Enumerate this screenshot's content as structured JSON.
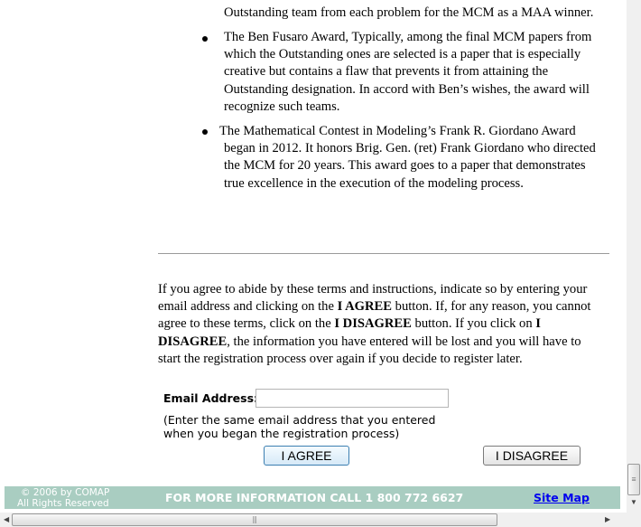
{
  "awards": {
    "top_line": "Outstanding team from each problem for the MCM as a MAA winner.",
    "items": [
      {
        "lines": [
          "The Ben Fusaro Award, Typically, among the final MCM papers from",
          "which the Outstanding ones are selected is a paper that is especially",
          "creative but contains a flaw that prevents it from attaining the",
          "Outstanding designation. In accord with Ben’s wishes, the award will",
          "recognize such teams."
        ]
      },
      {
        "lines": [
          "The Mathematical Contest in Modeling’s Frank R. Giordano Award",
          "began in 2012. It honors Brig. Gen. (ret) Frank Giordano who directed",
          "the MCM for 20 years. This award goes to a paper that demonstrates",
          "true excellence in the execution of the modeling process."
        ]
      }
    ]
  },
  "terms": {
    "lines": [
      [
        "If you agree to abide by these terms and instructions, indicate so by entering your"
      ],
      [
        "email address and clicking on the ",
        {
          "b": "I AGREE"
        },
        " button. If, for any reason, you cannot"
      ],
      [
        "agree to these terms, click on the ",
        {
          "b": "I DISAGREE"
        },
        " button. If you click on ",
        {
          "b": "I"
        }
      ],
      [
        {
          "b": "DISAGREE"
        },
        ", the information you have entered will be lost and you will have to"
      ],
      [
        "start the registration process over again if you decide to register later."
      ]
    ]
  },
  "form": {
    "email_label": "Email Address:",
    "email_value": "",
    "note_line1": "(Enter the same email address that you entered",
    "note_line2": "when you began the registration process)",
    "agree_label": "I  AGREE",
    "disagree_label": "I DISAGREE"
  },
  "footer": {
    "copyright": "© 2006 by COMAP",
    "rights": "All Rights Reserved",
    "info": "FOR MORE INFORMATION CALL 1 800 772 6627",
    "site_map": "Site Map",
    "bg_color": "#a9cdc1",
    "link_color": "#0000ee"
  }
}
